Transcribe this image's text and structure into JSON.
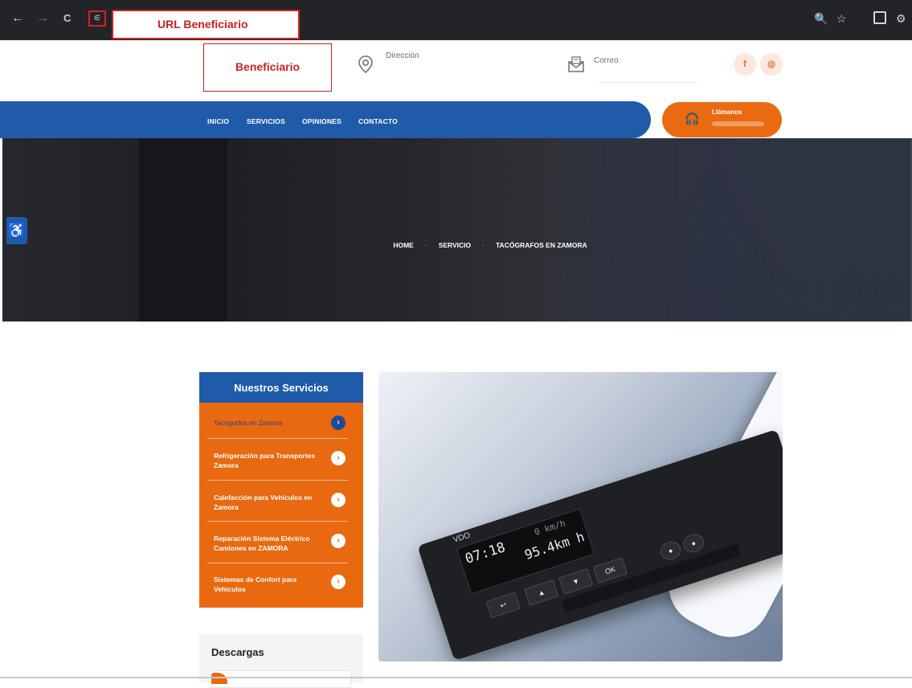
{
  "browser": {
    "back_icon": "←",
    "forward_icon": "→",
    "reload_icon": "C",
    "tune_icon": "tune-icon",
    "url_label": "URL Beneficiario",
    "zoom_icon": "🔍",
    "star_icon": "☆",
    "extensions_icon": "⚙"
  },
  "header": {
    "beneficiary_label": "Beneficiario",
    "address_label": "Dirección",
    "email_label": "Correo",
    "social_icons": [
      "facebook-icon",
      "instagram-icon"
    ]
  },
  "nav": {
    "items": [
      "INICIO",
      "SERVICIOS",
      "OPINIONES",
      "CONTACTO"
    ],
    "call_label": "Llámanos"
  },
  "hero": {
    "title": "Tacógrafos en Zamora",
    "breadcrumb": [
      "HOME",
      "SERVICIO",
      "TACÓGRAFOS EN ZAMORA"
    ]
  },
  "sidebar": {
    "title": "Nuestros Servicios",
    "items": [
      {
        "label": "Tacógrafos en Zamora",
        "active": true
      },
      {
        "label": "Refrigeración para Transportes Zamora",
        "active": false
      },
      {
        "label": "Calefacción para Vehículos en Zamora",
        "active": false
      },
      {
        "label": "Reparación Sistema Eléctrico Camiones en ZAMORA",
        "active": false
      },
      {
        "label": "Sistemas de Confort para Vehiculos",
        "active": false
      }
    ],
    "downloads_title": "Descargas"
  },
  "photo": {
    "brand": "VDO",
    "display_time": "07:18",
    "display_speed": "0 km/h",
    "display_distance": "95.4km h",
    "keys": [
      "↩",
      "▲",
      "▼",
      "OK",
      "●",
      "●"
    ]
  },
  "colors": {
    "primary_blue": "#1f5ba8",
    "accent_orange": "#e8690f",
    "annotation_red": "#c81f1f"
  }
}
